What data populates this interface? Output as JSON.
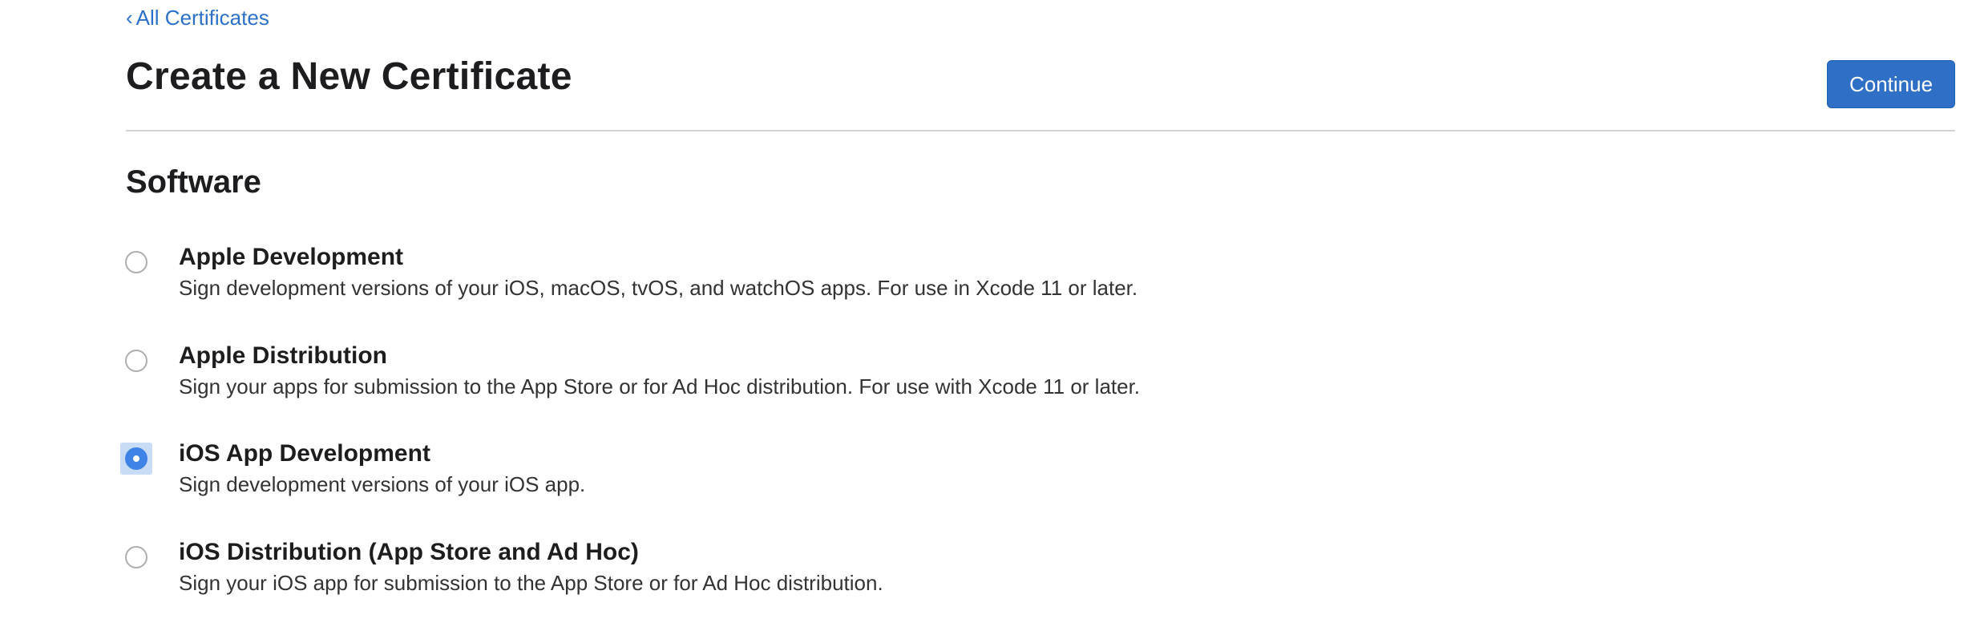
{
  "nav": {
    "back_chevron": "‹",
    "back_label": "All Certificates"
  },
  "header": {
    "title": "Create a New Certificate",
    "continue_label": "Continue"
  },
  "section": {
    "title": "Software"
  },
  "options": [
    {
      "title": "Apple Development",
      "description": "Sign development versions of your iOS, macOS, tvOS, and watchOS apps. For use in Xcode 11 or later.",
      "selected": false
    },
    {
      "title": "Apple Distribution",
      "description": "Sign your apps for submission to the App Store or for Ad Hoc distribution. For use with Xcode 11 or later.",
      "selected": false
    },
    {
      "title": "iOS App Development",
      "description": "Sign development versions of your iOS app.",
      "selected": true
    },
    {
      "title": "iOS Distribution (App Store and Ad Hoc)",
      "description": "Sign your iOS app for submission to the App Store or for Ad Hoc distribution.",
      "selected": false
    }
  ],
  "colors": {
    "accent": "#2f6fc6",
    "link": "#2c70c9",
    "radio_selected": "#3f83e6",
    "divider": "#d2d2d7"
  }
}
